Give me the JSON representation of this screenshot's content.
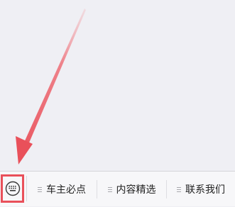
{
  "menu": {
    "keyboard_toggle_icon": "keyboard-icon",
    "highlight_color": "#e9505a",
    "items": [
      {
        "label": "车主必点",
        "icon": "menu-lines-icon"
      },
      {
        "label": "内容精选",
        "icon": "menu-lines-icon"
      },
      {
        "label": "联系我们",
        "icon": "menu-lines-icon"
      }
    ]
  },
  "annotation": {
    "arrow_color": "#e9505a"
  }
}
